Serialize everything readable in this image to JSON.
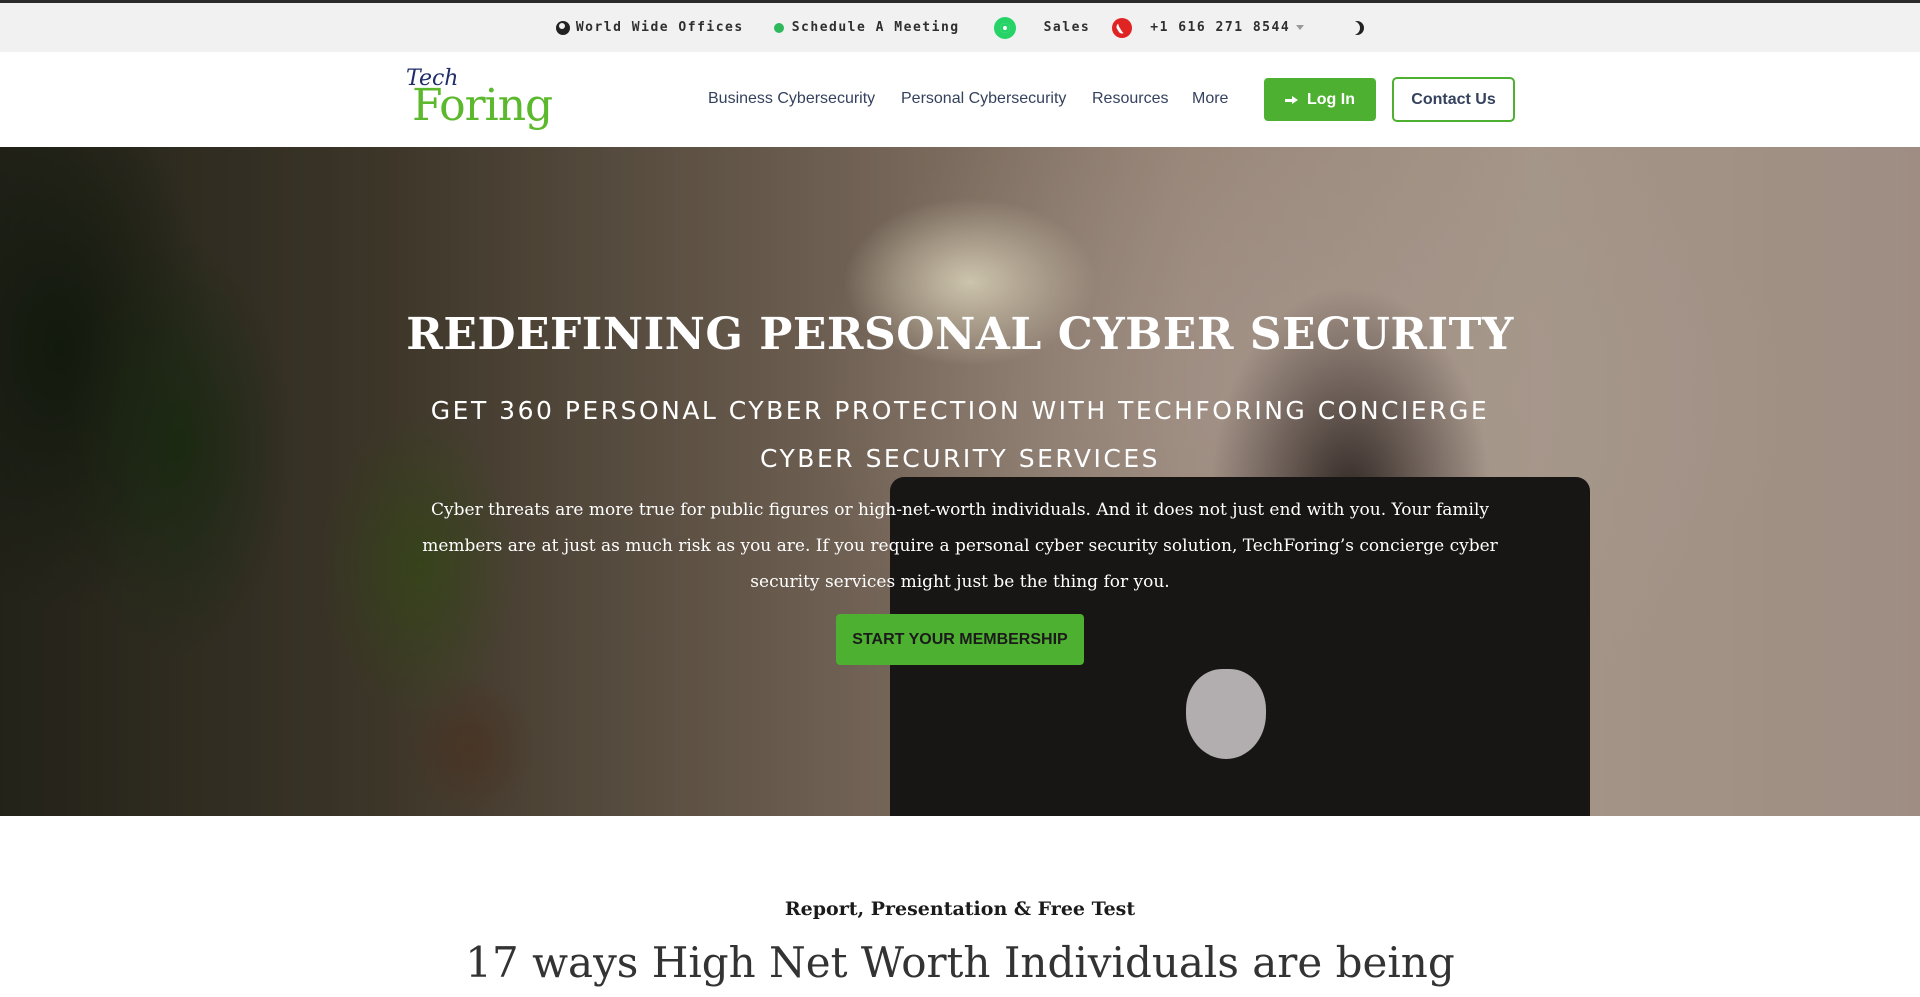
{
  "topbar": {
    "offices_label": "World Wide Offices",
    "meeting_label": "Schedule A Meeting",
    "sales_label": "Sales",
    "phone": "+1 616 271 8544"
  },
  "nav": {
    "logo_tech": "Tech",
    "logo_foring": "Foring",
    "links": [
      "Business Cybersecurity",
      "Personal Cybersecurity",
      "Resources",
      "More"
    ],
    "login_label": "Log In",
    "contact_label": "Contact Us"
  },
  "hero": {
    "title": "REDEFINING PERSONAL CYBER SECURITY",
    "subtitle": "GET 360 PERSONAL CYBER PROTECTION WITH TECHFORING CONCIERGE CYBER SECURITY SERVICES",
    "description": "Cyber threats are more true for public figures or high-net-worth individuals. And it does not just end with you. Your family members are at just as much risk as you are. If you require a personal cyber security solution, TechForing’s concierge cyber security services might just be the thing for you.",
    "cta_label": "START YOUR MEMBERSHIP"
  },
  "section": {
    "kicker": "Report, Presentation & Free Test",
    "title": "17 ways High Net Worth Individuals are being"
  },
  "colors": {
    "accent_green": "#4db030",
    "nav_text": "#35425e",
    "topbar_bg": "#f1f1f1"
  },
  "icons": [
    "globe-icon",
    "dot-icon",
    "whatsapp-icon",
    "phone-icon",
    "caret-down-icon",
    "moon-icon",
    "login-icon",
    "apple-logo-icon"
  ]
}
